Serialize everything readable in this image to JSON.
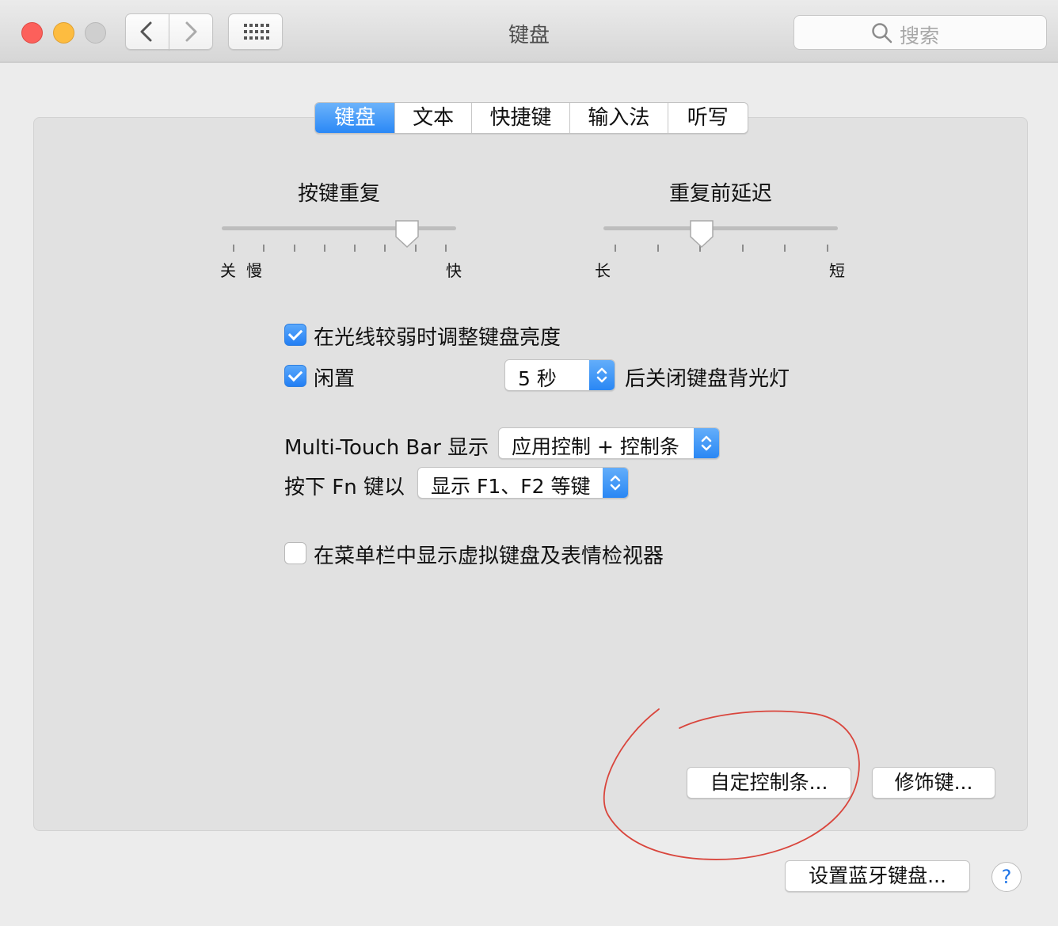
{
  "window": {
    "title": "键盘",
    "search_placeholder": "搜索"
  },
  "colors": {
    "close": "#fc605b",
    "minimize": "#fdbc40",
    "zoom_disabled": "#cfcfcf",
    "accent": "#2a88f6",
    "annotation": "#d9453c"
  },
  "icons": {
    "back": "chevron-left-icon",
    "forward": "chevron-right-icon",
    "grid": "grid-icon",
    "search": "search-icon"
  },
  "tabs": [
    {
      "label": "键盘",
      "selected": true
    },
    {
      "label": "文本",
      "selected": false
    },
    {
      "label": "快捷键",
      "selected": false
    },
    {
      "label": "输入法",
      "selected": false
    },
    {
      "label": "听写",
      "selected": false
    }
  ],
  "key_repeat": {
    "label": "按键重复",
    "min_label": "关",
    "slow_label": "慢",
    "max_label": "快",
    "ticks": 8,
    "value_fraction": 0.82
  },
  "delay_until_repeat": {
    "label": "重复前延迟",
    "min_label": "长",
    "max_label": "短",
    "ticks": 6,
    "value_fraction": 0.41
  },
  "options": {
    "adjust_brightness": {
      "label": "在光线较弱时调整键盘亮度",
      "checked": true
    },
    "idle": {
      "label": "闲置",
      "checked": true,
      "duration": "5 秒",
      "suffix": "后关闭键盘背光灯"
    },
    "touch_bar": {
      "label": "Multi-Touch Bar 显示",
      "value": "应用控制 + 控制条"
    },
    "fn_key": {
      "label": "按下 Fn 键以",
      "value": "显示 F1、F2 等键"
    },
    "show_viewer": {
      "label": "在菜单栏中显示虚拟键盘及表情检视器",
      "checked": false
    }
  },
  "buttons": {
    "customize_control_strip": "自定控制条...",
    "modifier_keys": "修饰键...",
    "bluetooth_keyboard": "设置蓝牙键盘...",
    "help": "?"
  }
}
